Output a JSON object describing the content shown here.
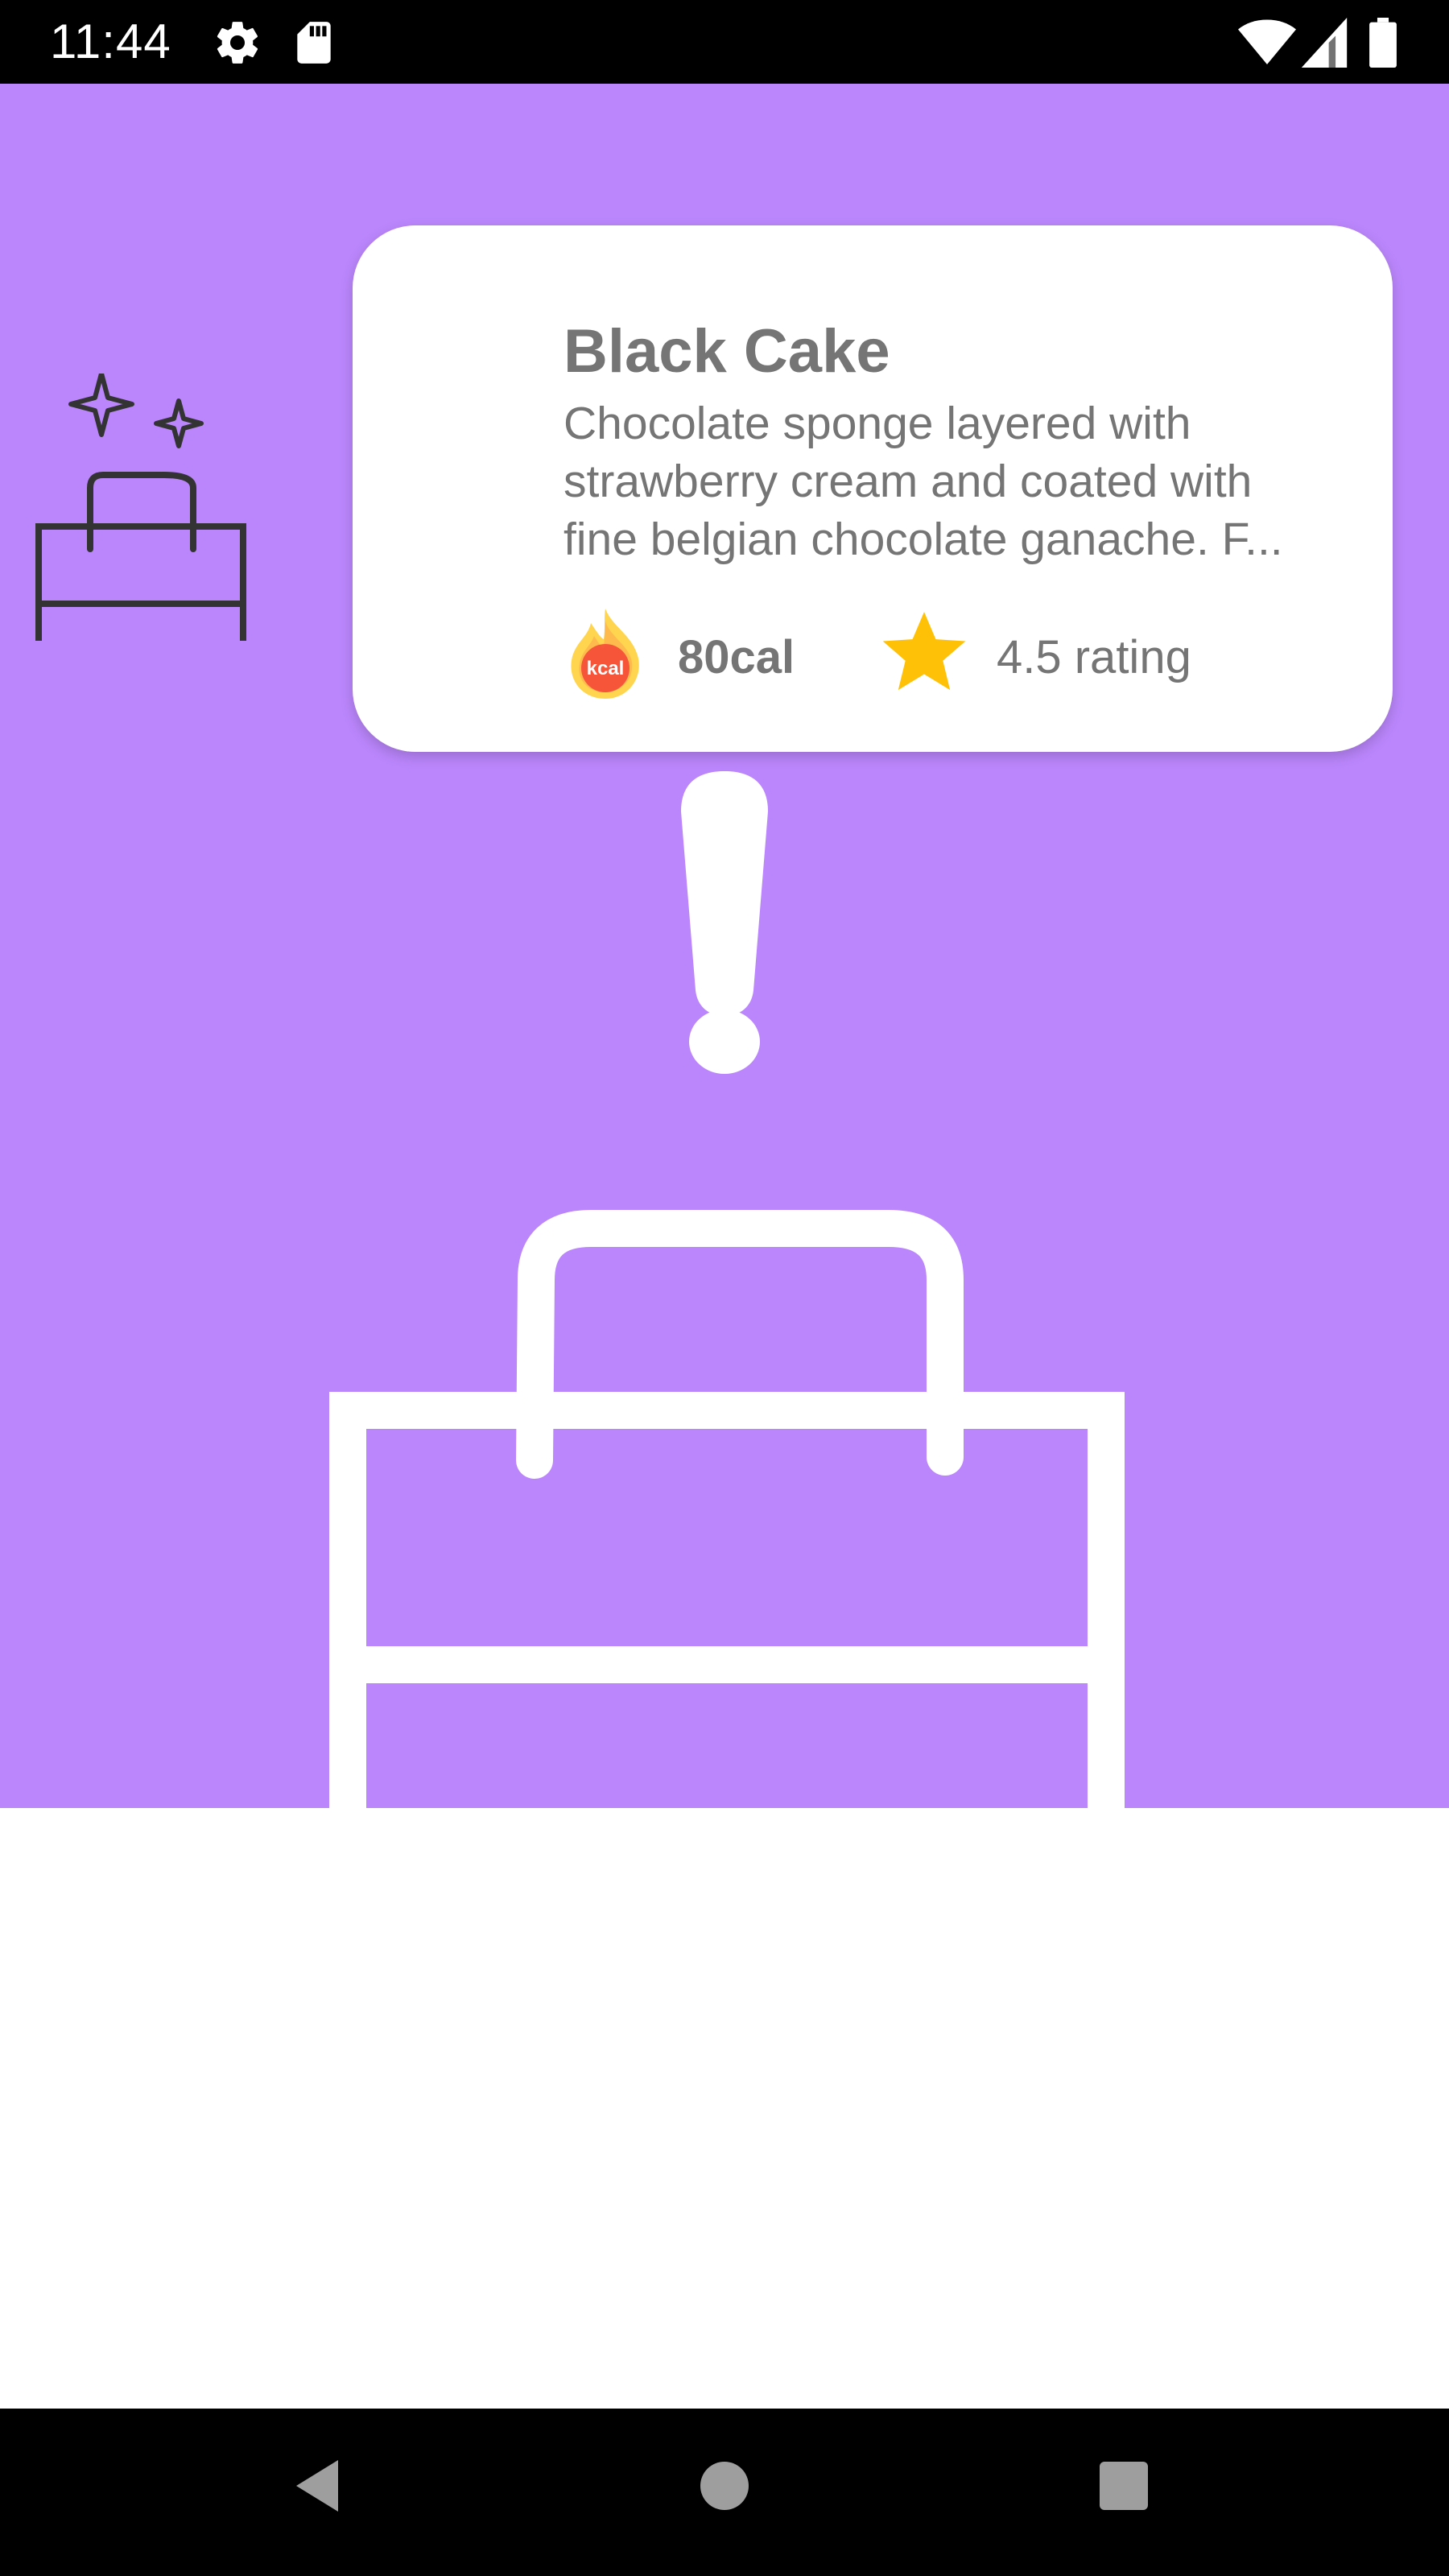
{
  "status_bar": {
    "time": "11:44",
    "icons": [
      "settings-icon",
      "sd-card-icon",
      "wifi-icon",
      "signal-icon",
      "battery-icon"
    ]
  },
  "card": {
    "title": "Black Cake",
    "description_lines": [
      "Chocolate sponge layered with",
      "strawberry cream and coated with",
      "fine belgian chocolate ganache. F..."
    ],
    "calories": "80cal",
    "rating": "4.5 rating",
    "calorie_icon_text": "kcal"
  },
  "colors": {
    "hero_background": "#bb86fc",
    "card_text": "#757575",
    "star": "#ffc107",
    "kcal_badge": "#f44336"
  },
  "nav_bar": {
    "buttons": [
      "back-icon",
      "home-icon",
      "recents-icon"
    ]
  }
}
